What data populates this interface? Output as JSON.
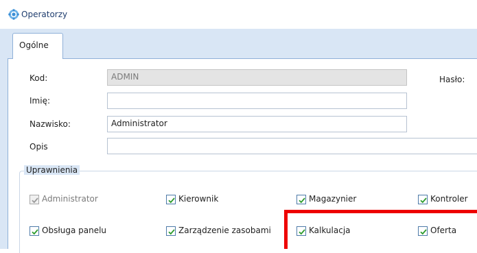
{
  "window": {
    "title": "Operatorzy",
    "icon": "operators-gear-icon"
  },
  "tabs": [
    {
      "label": "Ogólne",
      "active": true
    }
  ],
  "form": {
    "kod": {
      "label": "Kod:",
      "value": "ADMIN"
    },
    "haslo": {
      "label": "Hasło:"
    },
    "imie": {
      "label": "Imię:",
      "value": ""
    },
    "nazwisko": {
      "label": "Nazwisko:",
      "value": "Administrator"
    },
    "opis": {
      "label": "Opis",
      "value": ""
    }
  },
  "permissions": {
    "title": "Uprawnienia",
    "items": [
      {
        "label": "Administrator",
        "checked": true,
        "disabled": true
      },
      {
        "label": "Kierownik",
        "checked": true
      },
      {
        "label": "Magazynier",
        "checked": true
      },
      {
        "label": "Kontroler",
        "checked": true
      },
      {
        "label": "Obsługa panelu",
        "checked": true
      },
      {
        "label": "Zarządzenie zasobami",
        "checked": true
      },
      {
        "label": "Kalkulacja",
        "checked": true
      },
      {
        "label": "Oferta",
        "checked": true
      }
    ]
  },
  "colors": {
    "highlight": "#ee0000",
    "check": "#2e9c2e",
    "frame": "#d9e6f5"
  }
}
